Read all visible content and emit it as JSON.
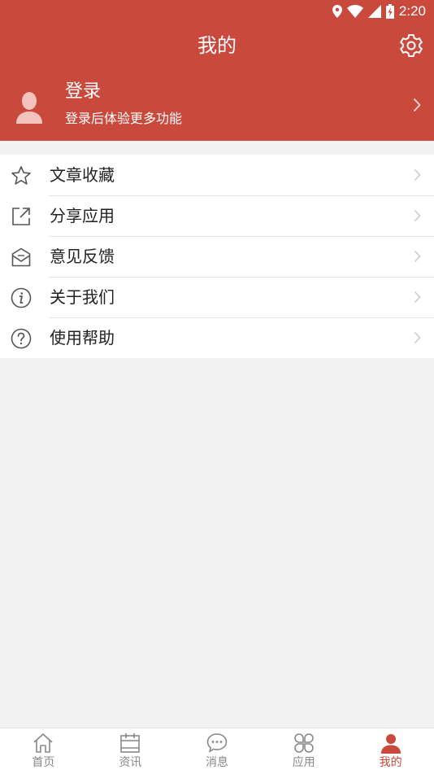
{
  "status_bar": {
    "time": "2:20",
    "icons": [
      "location-icon",
      "wifi-icon",
      "signal-icon",
      "battery-charging-icon"
    ]
  },
  "header": {
    "title": "我的",
    "settings_icon": "gear-icon"
  },
  "profile": {
    "title": "登录",
    "subtitle": "登录后体验更多功能",
    "avatar_icon": "avatar-icon"
  },
  "menu": {
    "items": [
      {
        "label": "文章收藏",
        "icon": "star-icon"
      },
      {
        "label": "分享应用",
        "icon": "share-icon"
      },
      {
        "label": "意见反馈",
        "icon": "mail-icon"
      },
      {
        "label": "关于我们",
        "icon": "info-icon"
      },
      {
        "label": "使用帮助",
        "icon": "help-icon"
      }
    ]
  },
  "tabs": {
    "active": "我的",
    "items": [
      {
        "label": "首页",
        "icon": "home-icon"
      },
      {
        "label": "资讯",
        "icon": "calendar-icon"
      },
      {
        "label": "消息",
        "icon": "chat-icon"
      },
      {
        "label": "应用",
        "icon": "apps-icon"
      },
      {
        "label": "我的",
        "icon": "person-icon"
      }
    ]
  },
  "colors": {
    "brand": "#c94a3d",
    "background": "#f2f2f2",
    "inactive_tab": "#888888"
  }
}
